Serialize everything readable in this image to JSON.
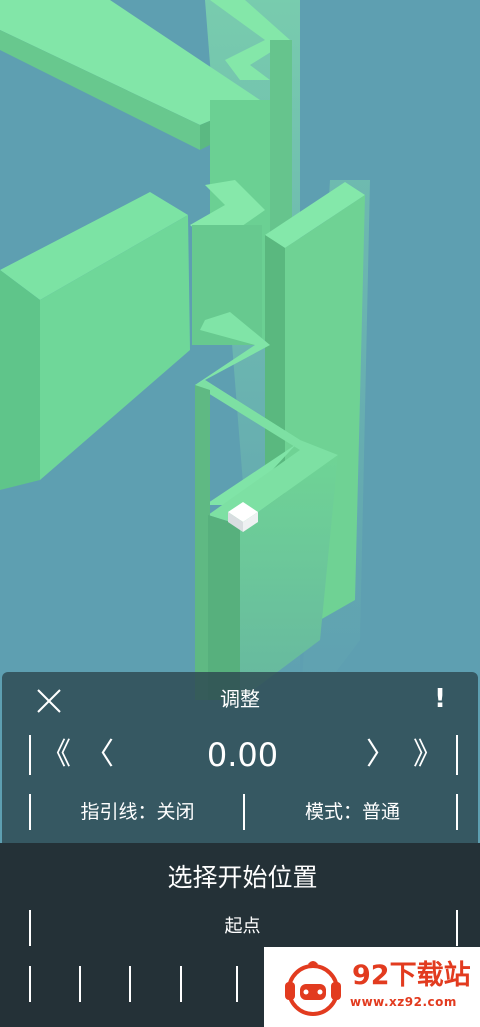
{
  "game_view": {
    "scene": "3d-zigzag-path-with-cube",
    "colors": {
      "background": "#5e9fb1",
      "path_top": "#7fe3a4",
      "path_side": "#5fc486",
      "beam": "#8ef0ac",
      "player": "#ffffff"
    }
  },
  "adjust_panel": {
    "title": "调整",
    "close_icon": "close-icon",
    "info_icon": "!",
    "nav": {
      "skip_back": "《",
      "step_back": "〈",
      "step_forward": "〉",
      "skip_forward": "》"
    },
    "offset_value": "0.00",
    "guide_line_option": "指引线：关闭",
    "mode_option": "模式：普通"
  },
  "start_position": {
    "title": "选择开始位置",
    "start_point": "起点"
  },
  "watermark": {
    "text": "92下载站",
    "url": "www.xz92.com"
  }
}
